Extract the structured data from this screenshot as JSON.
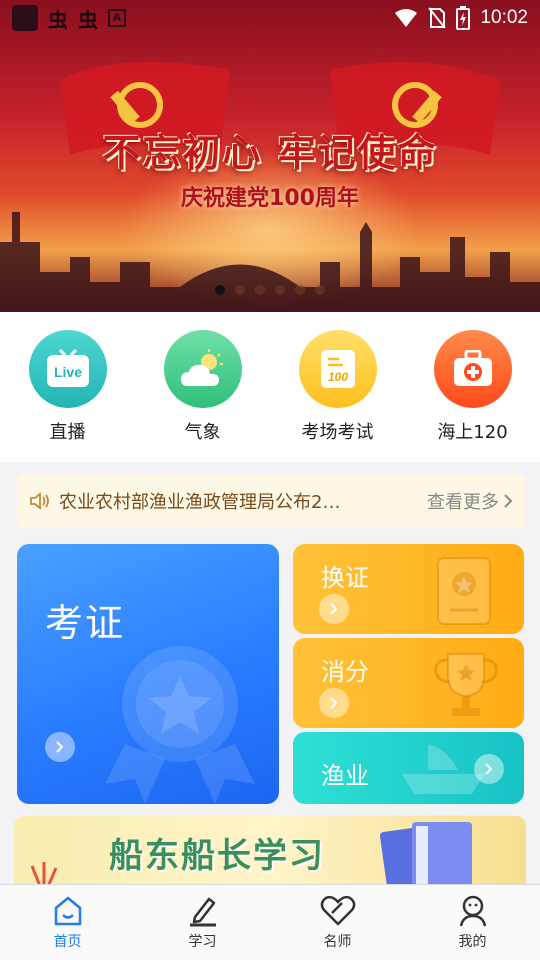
{
  "status_bar": {
    "left_glyphs": [
      "虫",
      "虫"
    ],
    "a_badge": "A",
    "time": "10:02"
  },
  "banner": {
    "slogan": "不忘初心 牢记使命",
    "subtitle": "庆祝建党100周年",
    "page_count": 6,
    "active_index": 0
  },
  "quick_menu": [
    {
      "label": "直播",
      "icon": "live-tv-icon",
      "icon_text": "Live"
    },
    {
      "label": "气象",
      "icon": "weather-icon"
    },
    {
      "label": "考场考试",
      "icon": "exam-paper-icon",
      "icon_text": "100"
    },
    {
      "label": "海上120",
      "icon": "first-aid-kit-icon"
    }
  ],
  "notice": {
    "text": "农业农村部渔业渔政管理局公布2…",
    "more": "查看更多"
  },
  "cards": {
    "exam": "考证",
    "renew": "换证",
    "points": "消分",
    "fishery": "渔业"
  },
  "study_banner": {
    "title": "船东船长学习"
  },
  "bottom_nav": [
    {
      "label": "首页",
      "icon": "home-icon",
      "active": true
    },
    {
      "label": "学习",
      "icon": "pen-icon",
      "active": false
    },
    {
      "label": "名师",
      "icon": "heart-icon",
      "active": false
    },
    {
      "label": "我的",
      "icon": "profile-icon",
      "active": false
    }
  ],
  "colors": {
    "accent": "#1e7bf2",
    "banner_red": "#c8222d",
    "card_blue": "#2a7dff",
    "card_orange": "#ffac12",
    "card_teal": "#17c2c6"
  }
}
